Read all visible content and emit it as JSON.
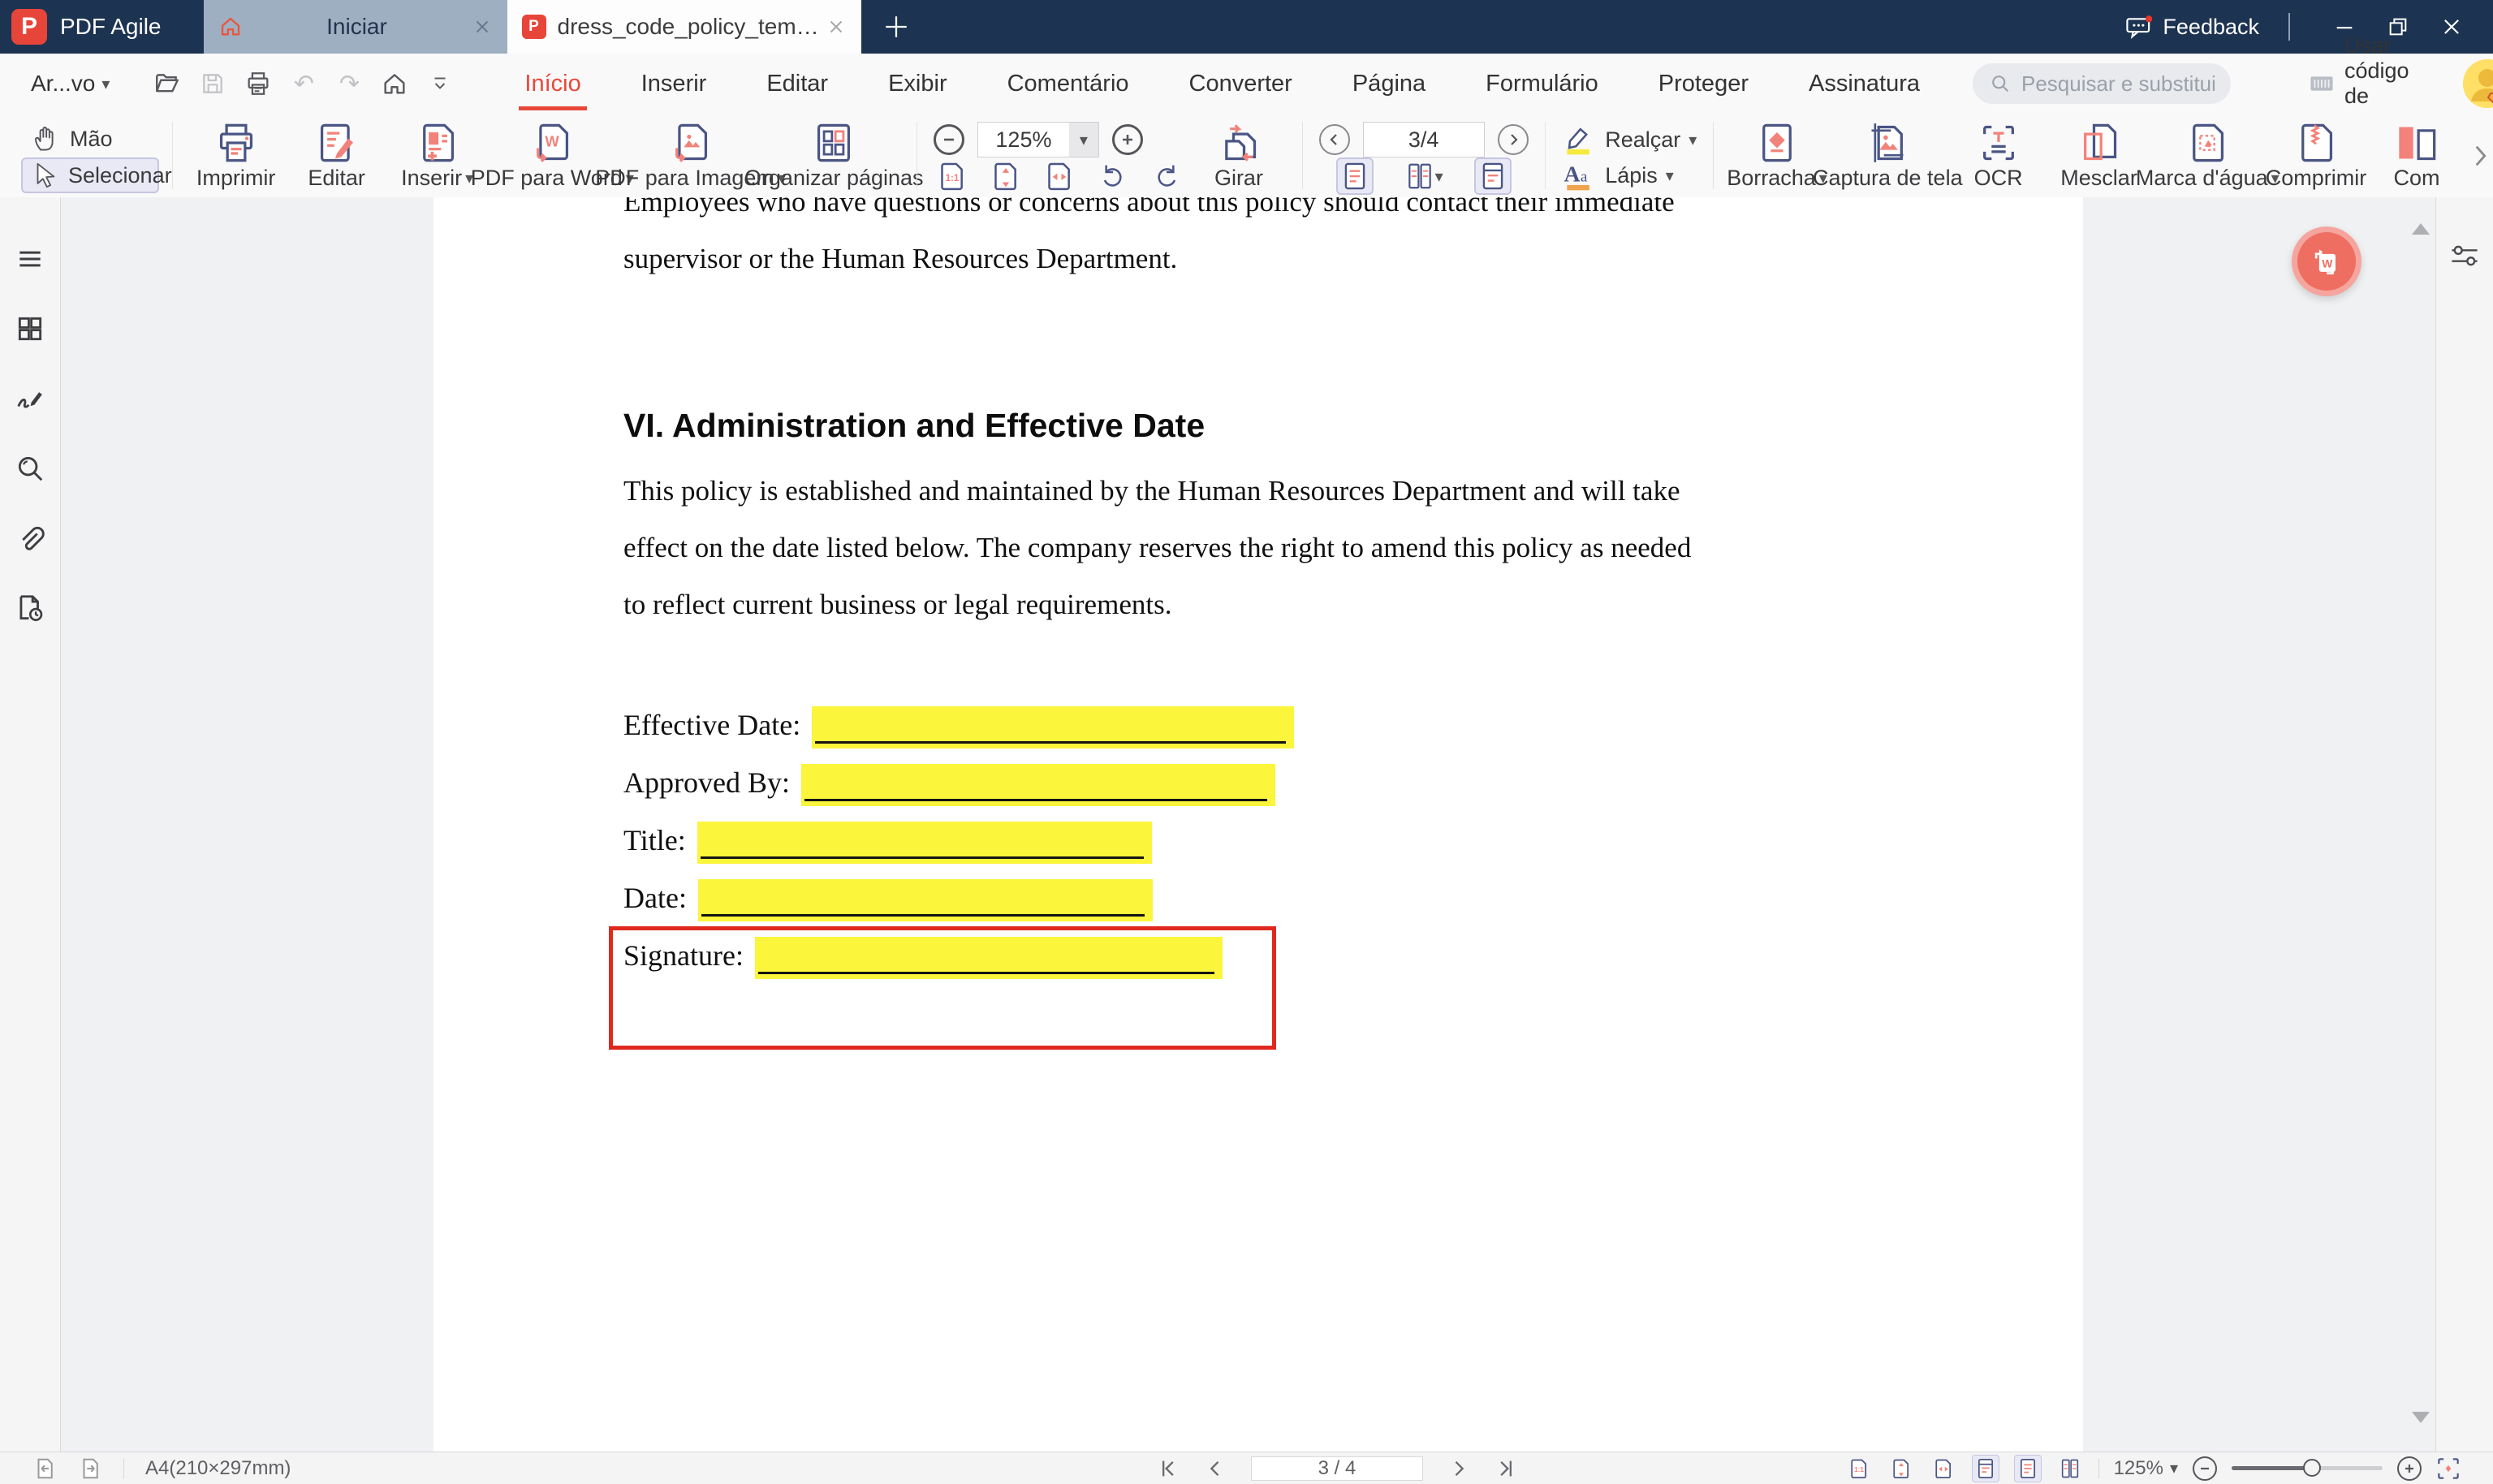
{
  "titlebar": {
    "app_name": "PDF Agile",
    "logo_letter": "P",
    "tabs": [
      {
        "label": "Iniciar",
        "active": false
      },
      {
        "label": "dress_code_policy_templat...",
        "active": true
      }
    ],
    "feedback_label": "Feedback"
  },
  "menubar": {
    "file_menu": "Ar...vo",
    "items": [
      "Início",
      "Inserir",
      "Editar",
      "Exibir",
      "Comentário",
      "Converter",
      "Página",
      "Formulário",
      "Proteger",
      "Assinatura"
    ],
    "active_item": "Início",
    "search_placeholder": "Pesquisar e substituir",
    "redeem_label": "Usar código de resgate"
  },
  "toolbar": {
    "hand_label": "Mão",
    "select_label": "Selecionar",
    "print_label": "Imprimir",
    "edit_label": "Editar",
    "insert_label": "Inserir",
    "pdf_to_word_label": "PDF para Word",
    "pdf_to_image_label": "PDF para Imagem",
    "organize_pages_label": "Organizar páginas",
    "zoom_value": "125%",
    "rotate_label": "Girar",
    "page_indicator": "3/4",
    "highlight_label": "Realçar",
    "pencil_label": "Lápis",
    "eraser_label": "Borracha",
    "screenshot_label": "Captura de tela",
    "ocr_label": "OCR",
    "merge_label": "Mesclar",
    "watermark_label": "Marca d'água",
    "compress_label": "Comprimir",
    "overflow_label": "Com"
  },
  "document": {
    "clipped_line": "Employees who have questions or concerns about this policy should contact their immediate",
    "line2": "supervisor or the Human Resources Department.",
    "heading": "VI. Administration and Effective Date",
    "para_line1": "This policy is established and maintained by the Human Resources Department and will take",
    "para_line2": "effect on the date listed below. The company reserves the right to amend this policy as needed",
    "para_line3": "to reflect current business or legal requirements.",
    "fields": [
      {
        "label": "Effective Date:"
      },
      {
        "label": "Approved By:"
      },
      {
        "label": "Title:"
      },
      {
        "label": "Date:"
      },
      {
        "label": "Signature:"
      }
    ]
  },
  "statusbar": {
    "page_size": "A4(210×297mm)",
    "page_indicator": "3 / 4",
    "zoom_value": "125%"
  },
  "icons": {
    "caret_down": "▾",
    "undo": "↶",
    "redo": "↷"
  },
  "colors": {
    "titlebar_bg": "#1C3351",
    "accent_red": "#E8483A",
    "icon_navy": "#4A5584",
    "icon_salmon": "#F2827A",
    "highlight_yellow": "#FBF53B",
    "annotation_red": "#E0291E",
    "selected_tool_bg": "#E9E9F6"
  }
}
